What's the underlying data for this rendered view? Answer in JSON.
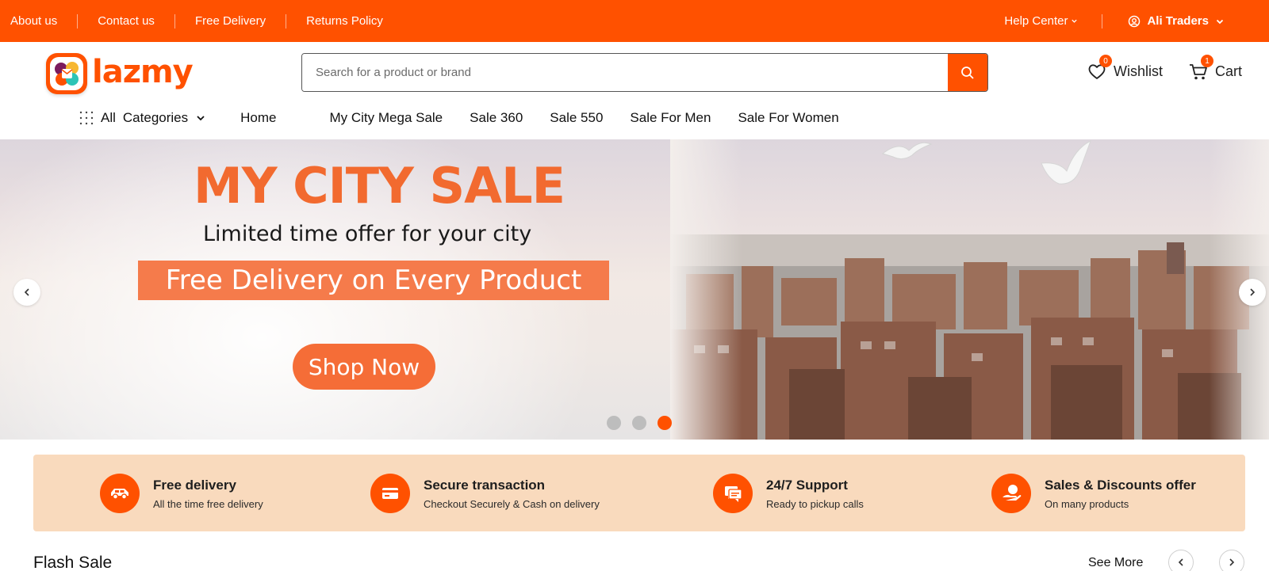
{
  "topbar": {
    "links": [
      "About us",
      "Contact us",
      "Free Delivery",
      "Returns Policy"
    ],
    "help": "Help Center",
    "account": "Ali Traders"
  },
  "header": {
    "logo": "lazmy",
    "search_placeholder": "Search for a product or brand",
    "wishlist": {
      "label": "Wishlist",
      "count": "0"
    },
    "cart": {
      "label": "Cart",
      "count": "1"
    }
  },
  "nav": {
    "categories_prefix": "All",
    "categories": "Categories",
    "items": [
      "Home",
      "My City Mega Sale",
      "Sale 360",
      "Sale 550",
      "Sale For Men",
      "Sale For Women"
    ]
  },
  "hero": {
    "title": "MY CITY SALE",
    "subtitle": "Limited time offer for your city",
    "band": "Free Delivery on Every Product",
    "cta": "Shop Now",
    "slide_count": 3,
    "active_slide": 3
  },
  "features": [
    {
      "title": "Free delivery",
      "subtitle": "All the time free delivery",
      "icon": "car-icon"
    },
    {
      "title": "Secure transaction",
      "subtitle": "Checkout Securely & Cash on delivery",
      "icon": "card-icon"
    },
    {
      "title": "24/7 Support",
      "subtitle": "Ready to pickup calls",
      "icon": "chat-icon"
    },
    {
      "title": "Sales & Discounts offer",
      "subtitle": "On many products",
      "icon": "offer-hand-icon"
    }
  ],
  "flash": {
    "title": "Flash Sale",
    "see_more": "See More"
  },
  "colors": {
    "brand": "#ff5100",
    "feature_bg": "#f9dabd",
    "hero_accent": "#f26a2f"
  }
}
